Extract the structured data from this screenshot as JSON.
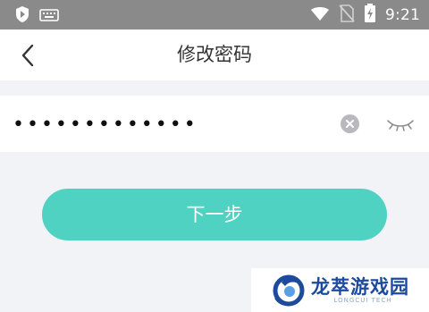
{
  "status_bar": {
    "time": "9:21",
    "icons": [
      "shield-icon",
      "keyboard-icon",
      "wifi-icon",
      "no-sim-icon",
      "battery-charging-icon"
    ]
  },
  "header": {
    "title": "修改密码",
    "back_icon": "chevron-left-icon"
  },
  "password_field": {
    "value": "•••••••••••••",
    "clear_icon": "clear-circle-icon",
    "visibility_icon": "eye-closed-icon"
  },
  "primary_button": {
    "label": "下一步",
    "color": "#4fd2c2"
  },
  "watermark": {
    "name": "龙萃游戏园",
    "subtitle": "LONGCUI TECH",
    "color": "#1c4a9c"
  }
}
